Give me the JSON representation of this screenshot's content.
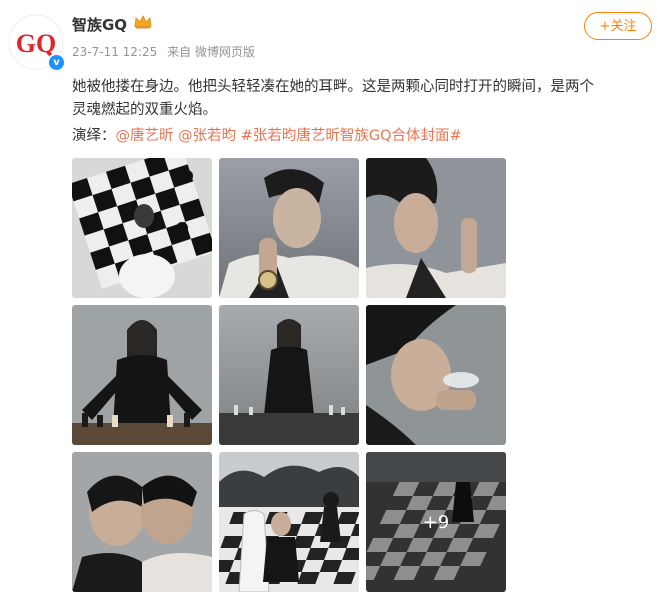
{
  "post": {
    "author": "智族GQ",
    "avatar_logo": "GQ",
    "verified_mark": "v",
    "timestamp": "23-7-11 12:25",
    "source": "来自 微博网页版",
    "follow_label": "+关注",
    "body_line1": "她被他搂在身边。他把头轻轻凑在她的耳畔。这是两颗心同时打开的瞬间，是两个",
    "body_line2": "灵魂燃起的双重火焰。",
    "credits_prefix": "演绎：",
    "mention1": "@唐艺昕",
    "mention2": "@张若昀",
    "hashtag": "#张若昀唐艺昕智族GQ合体封面#",
    "more_photos": "+9"
  },
  "colors": {
    "accent": "#ff8200",
    "link": "#eb7350",
    "meta": "#939393",
    "verified": "#1e90ff"
  }
}
